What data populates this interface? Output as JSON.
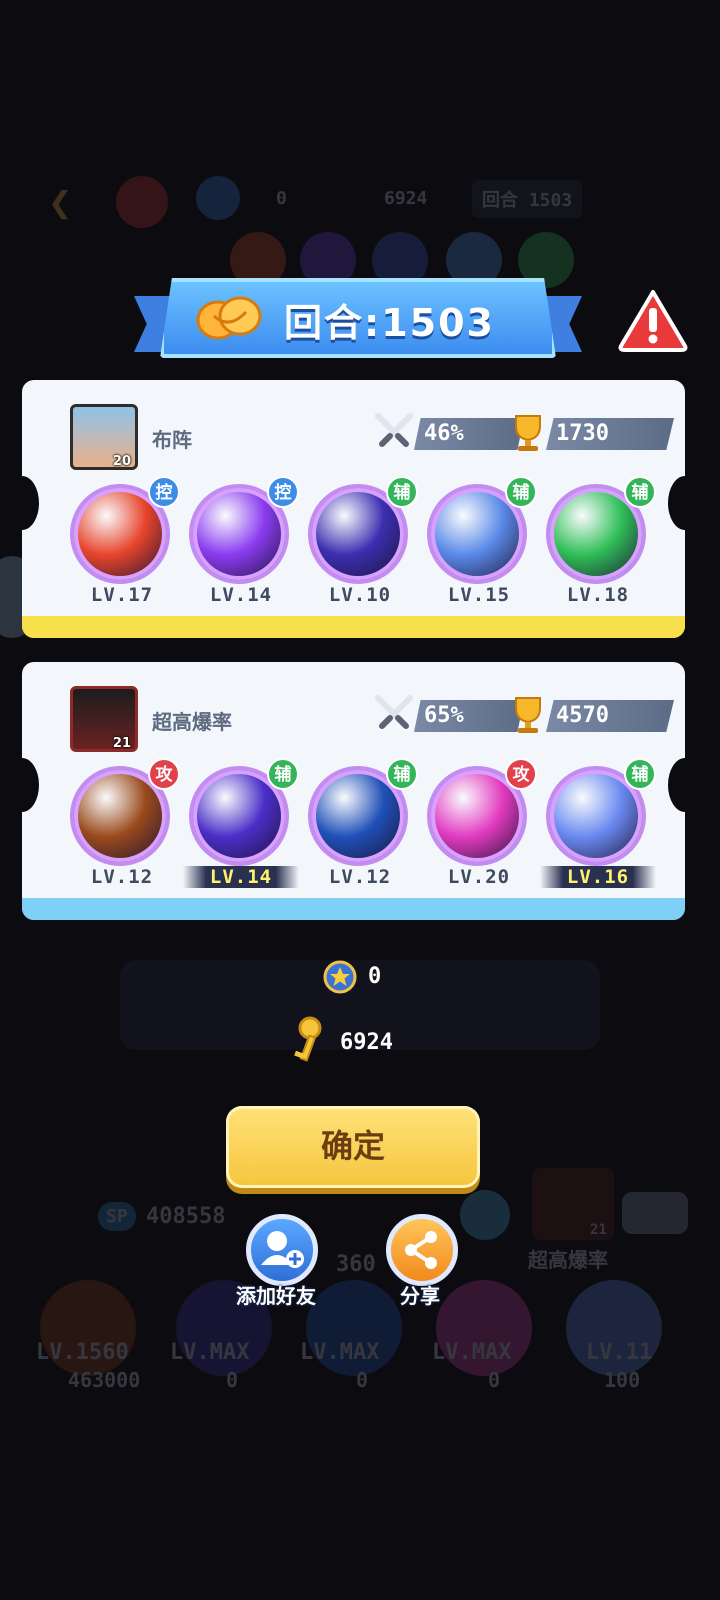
{
  "background": {
    "top_keys": "6924",
    "top_stars": "0",
    "top_round": "回合 1503",
    "sp_total": "408558",
    "sp_label": "SP",
    "mid_number": "360",
    "friend_name": "超高爆率",
    "friend_level": "21",
    "bottom_levels": [
      "LV.1560",
      "LV.MAX",
      "LV.MAX",
      "LV.MAX",
      "LV.11"
    ],
    "bottom_sp": [
      "463000",
      "0",
      "0",
      "0",
      "100"
    ]
  },
  "header": {
    "round_label": "回合:1503"
  },
  "panels": [
    {
      "name": "布阵",
      "avatar_level": "20",
      "win_rate": "46%",
      "trophies": "1730",
      "accent": "#f7e04a",
      "units": [
        {
          "tag": "控",
          "level": "LV.17",
          "highlight": false,
          "orb": "#e8452c",
          "tagColor": "#3c8ce8"
        },
        {
          "tag": "控",
          "level": "LV.14",
          "highlight": false,
          "orb": "#8a3cf0",
          "tagColor": "#3c8ce8"
        },
        {
          "tag": "辅",
          "level": "LV.10",
          "highlight": false,
          "orb": "#3b2fb0",
          "tagColor": "#34b55a"
        },
        {
          "tag": "辅",
          "level": "LV.15",
          "highlight": false,
          "orb": "#5a8ae8",
          "tagColor": "#34b55a"
        },
        {
          "tag": "辅",
          "level": "LV.18",
          "highlight": false,
          "orb": "#2fbf58",
          "tagColor": "#34b55a"
        }
      ]
    },
    {
      "name": "超高爆率",
      "avatar_level": "21",
      "win_rate": "65%",
      "trophies": "4570",
      "accent": "#7fd0f6",
      "units": [
        {
          "tag": "攻",
          "level": "LV.12",
          "highlight": false,
          "orb": "#9a4a1c",
          "tagColor": "#e0414a"
        },
        {
          "tag": "辅",
          "level": "LV.14",
          "highlight": true,
          "orb": "#4a2fc8",
          "tagColor": "#34b55a"
        },
        {
          "tag": "辅",
          "level": "LV.12",
          "highlight": false,
          "orb": "#2050b8",
          "tagColor": "#34b55a"
        },
        {
          "tag": "攻",
          "level": "LV.20",
          "highlight": false,
          "orb": "#e23bc0",
          "tagColor": "#e0414a"
        },
        {
          "tag": "辅",
          "level": "LV.16",
          "highlight": true,
          "orb": "#6a8af0",
          "tagColor": "#34b55a"
        }
      ]
    }
  ],
  "rewards": {
    "stars": "0",
    "keys": "6924"
  },
  "buttons": {
    "confirm": "确定",
    "add_friend": "添加好友",
    "share": "分享"
  }
}
